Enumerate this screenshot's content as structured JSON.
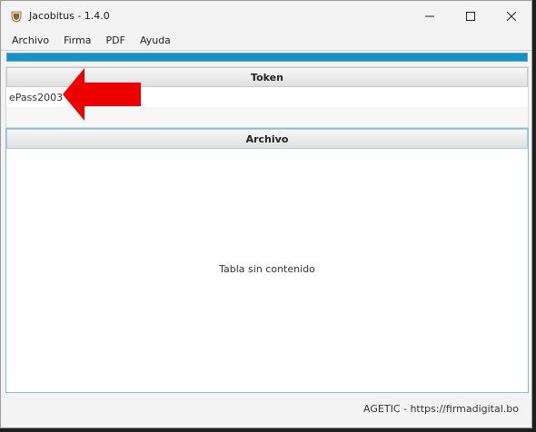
{
  "window": {
    "title": "Jacobitus - 1.4.0",
    "controls": [
      "minimize-icon",
      "maximize-icon",
      "close-icon"
    ]
  },
  "menu": {
    "items": [
      "Archivo",
      "Firma",
      "PDF",
      "Ayuda"
    ]
  },
  "progress": {
    "fraction": 1.0,
    "color": "#1a8fc4"
  },
  "token": {
    "header": "Token",
    "rows": [
      "ePass2003",
      ""
    ]
  },
  "archivo": {
    "header": "Archivo",
    "empty_message": "Tabla sin contenido"
  },
  "footer": {
    "text": "AGETIC - https://firmadigital.bo"
  },
  "annotation": {
    "icon": "red-arrow-icon",
    "color": "#ee0000"
  }
}
